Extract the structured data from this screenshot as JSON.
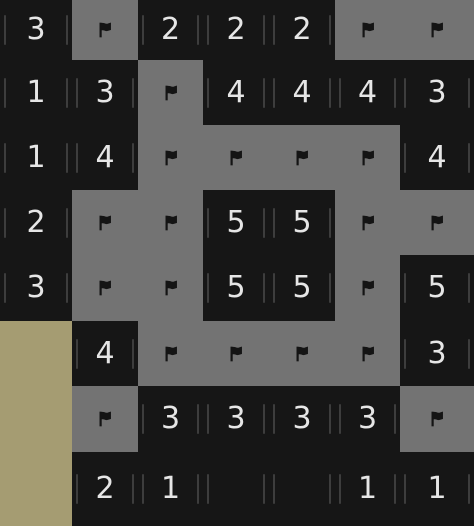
{
  "board": {
    "rows": [
      [
        "3",
        "F",
        "2",
        "2",
        "2",
        "F",
        "F"
      ],
      [
        "1",
        "3",
        "F",
        "4",
        "4",
        "4",
        "3"
      ],
      [
        "1",
        "4",
        "F",
        "F",
        "F",
        "F",
        "4"
      ],
      [
        "2",
        "F",
        "F",
        "5",
        "5",
        "F",
        "F"
      ],
      [
        "3",
        "F",
        "F",
        "5",
        "5",
        "F",
        "5"
      ],
      [
        "U",
        "4",
        "F",
        "F",
        "F",
        "F",
        "3"
      ],
      [
        "U",
        "F",
        "3",
        "3",
        "3",
        "3",
        "F"
      ],
      [
        "U",
        "2",
        "1",
        "",
        "",
        "1",
        "1"
      ]
    ],
    "legend": {
      "F": "flag-icon",
      "U": "unrevealed",
      "": "empty-revealed"
    }
  },
  "colors": {
    "background": "#1c1c1c",
    "revealed_cell": "#161616",
    "flagged_cell": "#737373",
    "unrevealed_cell": "#a59c72",
    "number_text": "#e6e6e6",
    "flag_icon": "#141414"
  }
}
